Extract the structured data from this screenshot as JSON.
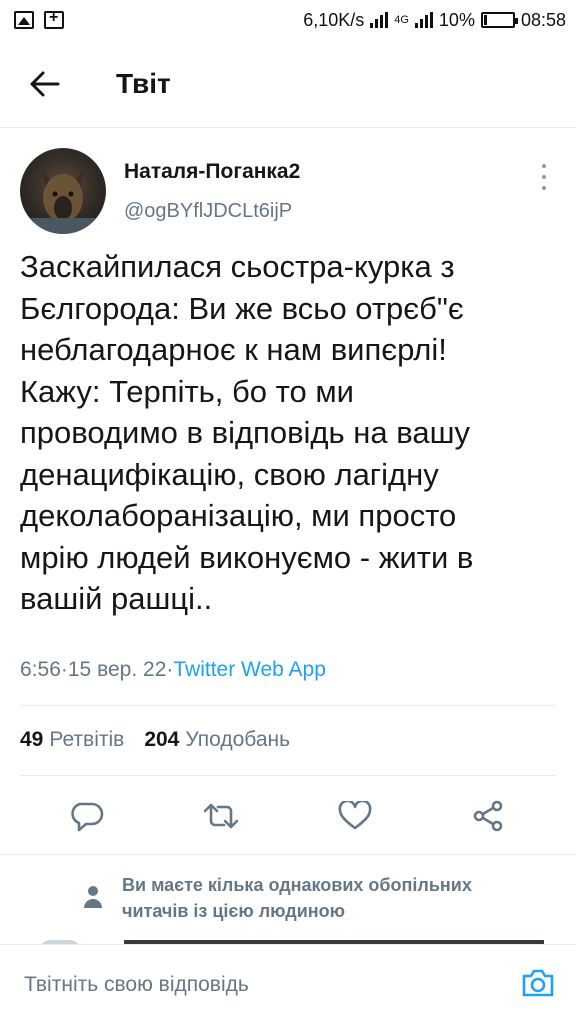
{
  "status_bar": {
    "speed": "6,10K/s",
    "network": "4G",
    "battery": "10%",
    "battery_level": 0.1,
    "time": "08:58"
  },
  "header": {
    "title": "Твіт",
    "back_icon": "arrow-left-icon"
  },
  "tweet": {
    "display_name": "Наталя-Поганка2",
    "handle": "@ogBYflJDCLt6ijP",
    "text": "Заскайпилася сьостра-курка з\nБєлгорода: Ви же всьо отрєб\"є\nнеблагодарноє к нам випєрлі!\nКажу: Терпіть, бо то ми\nпроводимо в відповідь на вашу\nденацифікацію, свою лагідну\nдеколаборанізацію, ми просто\nмрію людей виконуємо - жити в\nвашій рашці..",
    "time": "6:56",
    "separator": " · ",
    "date": "15 вер. 22",
    "app": "Twitter Web App",
    "retweets_count": "49",
    "retweets_label": "Ретвітів",
    "likes_count": "204",
    "likes_label": "Уподобань"
  },
  "actions": [
    "reply-icon",
    "retweet-icon",
    "like-icon",
    "share-icon"
  ],
  "followers_note": "Ви маєте кілька однакових обопільних читачів із цією людиною",
  "reply": {
    "placeholder": "Твітніть свою відповідь"
  },
  "colors": {
    "accent": "#1da1f2",
    "secondary_text": "#657786",
    "primary_text": "#14171a"
  }
}
